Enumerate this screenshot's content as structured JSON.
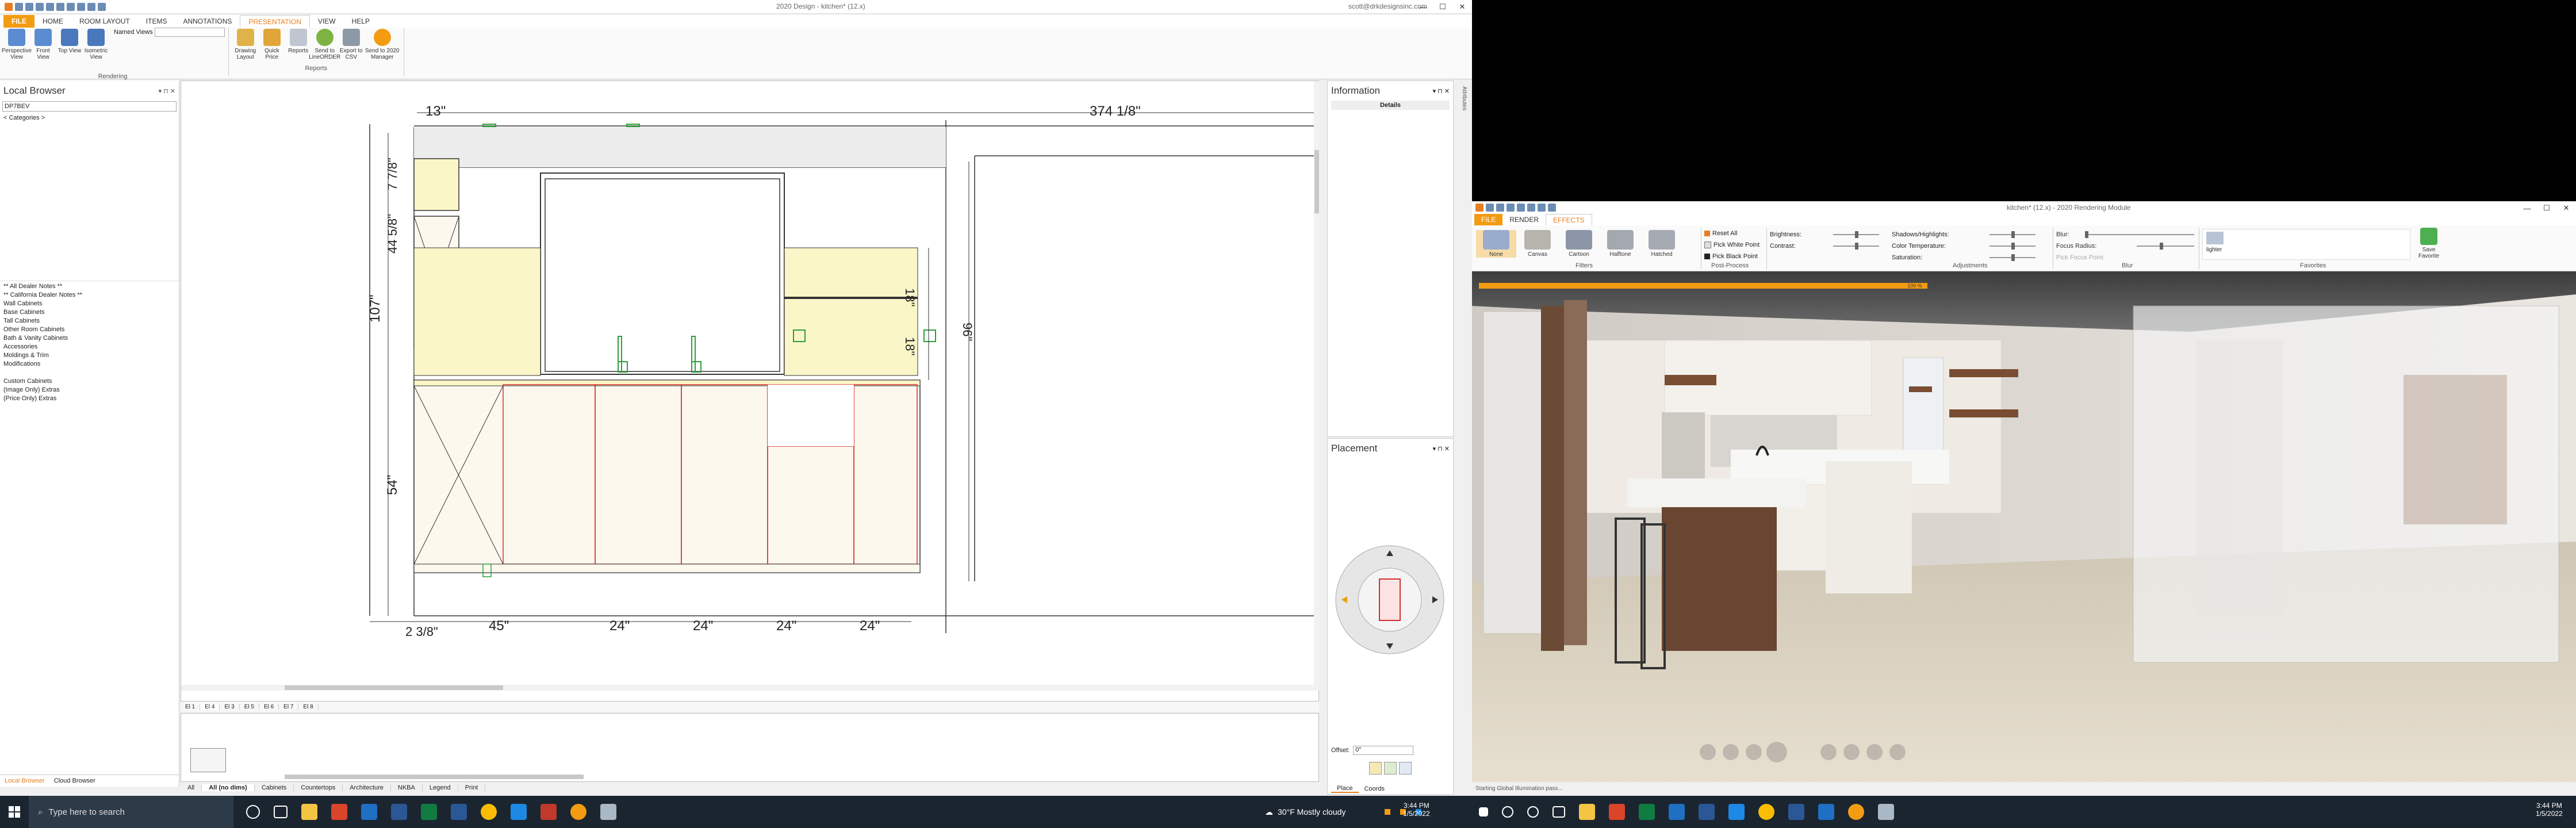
{
  "left_app": {
    "title": "2020 Design - kitchen* (12.x)",
    "user_email": "scott@drkdesignsinc.com",
    "tabs": [
      "FILE",
      "HOME",
      "ROOM LAYOUT",
      "ITEMS",
      "ANNOTATIONS",
      "PRESENTATION",
      "VIEW",
      "HELP"
    ],
    "active_tab": "PRESENTATION",
    "ribbon": {
      "views_buttons": [
        "Perspective View",
        "Front View",
        "Top View",
        "Isometric View"
      ],
      "named_views_label": "Named Views",
      "rendering_label": "Rendering",
      "report_buttons": [
        "Drawing Layout",
        "Quick Price",
        "Reports",
        "Send to LineORDER",
        "Export to CSV",
        "Send to 2020 Manager"
      ],
      "reports_label": "Reports"
    },
    "local_browser": {
      "title": "Local Browser",
      "search_value": "DP7BEV",
      "categories_label": "< Categories >",
      "items": [
        "** All Dealer Notes **",
        "** California Dealer Notes **",
        "Wall Cabinets",
        "Base Cabinets",
        "Tall Cabinets",
        "Other Room Cabinets",
        "Bath & Vanity Cabinets",
        "Accessories",
        "Moldings & Trim",
        "Modifications",
        "",
        "Custom Cabinets",
        "(Image Only) Extras",
        "(Price Only) Extras"
      ],
      "bottom_tabs": [
        "Local Browser",
        "Cloud Browser"
      ]
    },
    "drawing": {
      "dims_top": [
        "13\"",
        "374 1/8\""
      ],
      "dims_left": [
        "7 7/8\"",
        "44 5/8\"",
        "107\"",
        "54\""
      ],
      "dims_right": [
        "18\"",
        "18\"",
        "96\""
      ],
      "dims_bottom": [
        "2 3/8\"",
        "45\"",
        "24\"",
        "24\"",
        "24\"",
        "24\""
      ],
      "elevation_tabs": [
        "El 1",
        "El 4",
        "El 3",
        "El 5",
        "El 6",
        "El 7",
        "El 8"
      ],
      "catalog_tabs": [
        "All",
        "All (no dims)",
        "Cabinets",
        "Countertops",
        "Architecture",
        "NKBA",
        "Legend",
        "Print"
      ]
    },
    "information": {
      "title": "Information",
      "details_label": "Details",
      "side_tab": "Attributes"
    },
    "placement": {
      "title": "Placement",
      "offset_label": "Offset:",
      "offset_value": "0\"",
      "bottom_tabs": [
        "Place",
        "Coords"
      ]
    }
  },
  "right_app": {
    "title": "kitchen* (12.x) - 2020 Rendering Module",
    "tabs": [
      "FILE",
      "RENDER",
      "EFFECTS"
    ],
    "active_tab": "EFFECTS",
    "filters": [
      "None",
      "Canvas",
      "Cartoon",
      "Halftone",
      "Hatched"
    ],
    "filters_label": "Filters",
    "post_process": [
      "Reset All",
      "Pick White Point",
      "Pick Black Point"
    ],
    "post_process_label": "Post-Process",
    "adjustments": [
      "Brightness:",
      "Contrast:",
      "Shadows/Highlights:",
      "Color Temperature:",
      "Saturation:"
    ],
    "adjustments_label": "Adjustments",
    "blur": [
      "Blur:",
      "Focus Radius:",
      "Pick Focus Point"
    ],
    "blur_label": "Blur",
    "favorite_name": "lighter",
    "favorites_label": "Favorites",
    "save_favorite": "Save Favorite",
    "progress_percent": 100,
    "progress_label": "100 %",
    "status_text": "Starting Global Illumination pass..."
  },
  "taskbar": {
    "search_placeholder": "Type here to search",
    "weather": "30°F  Mostly cloudy",
    "left_clock_time": "3:44 PM",
    "left_clock_date": "1/5/2022",
    "right_clock_time": "3:44 PM",
    "right_clock_date": "1/5/2022"
  },
  "colors": {
    "accent_orange": "#f39c12",
    "cabinet_yellow": "#fbf6c8",
    "cabinet_cream": "#fdf8ee",
    "cabinet_outline": "#d32f2f"
  }
}
